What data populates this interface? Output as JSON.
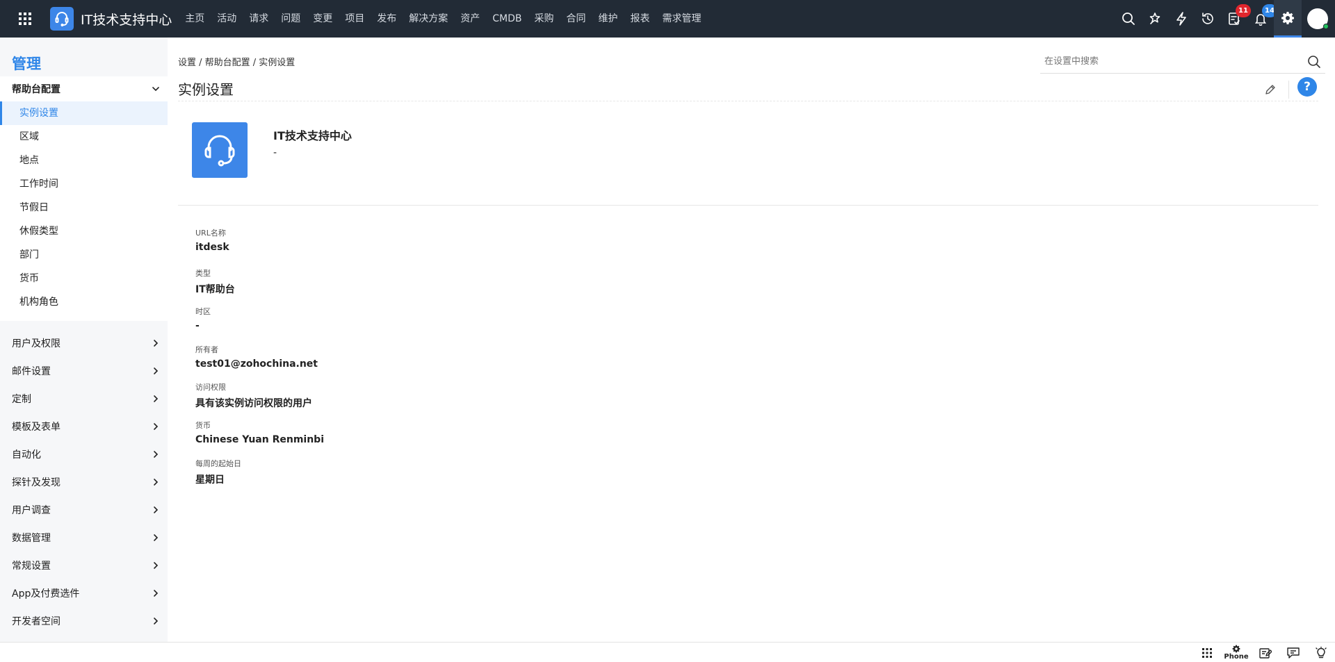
{
  "topbar": {
    "app_title": "IT技术支持中心",
    "nav": [
      "主页",
      "活动",
      "请求",
      "问题",
      "变更",
      "项目",
      "发布",
      "解决方案",
      "资产",
      "CMDB",
      "采购",
      "合同",
      "维护",
      "报表",
      "需求管理"
    ],
    "icons": [
      "search-icon",
      "magic-icon",
      "bolt-icon",
      "history-icon",
      "tasks-icon",
      "bell-icon",
      "gear-icon",
      "avatar"
    ],
    "tasks_badge": "11",
    "notifications_badge": "14",
    "active_color": "#2f86e8",
    "online_color": "#23c15d"
  },
  "sidebar": {
    "title": "管理",
    "group": {
      "label": "帮助台配置",
      "items": [
        "实例设置",
        "区域",
        "地点",
        "工作时间",
        "节假日",
        "休假类型",
        "部门",
        "货币",
        "机构角色"
      ]
    },
    "sections": [
      "用户及权限",
      "邮件设置",
      "定制",
      "模板及表单",
      "自动化",
      "探针及发现",
      "用户调查",
      "数据管理",
      "常规设置",
      "App及付费选件",
      "开发者空间"
    ]
  },
  "main": {
    "breadcrumb": "设置 / 帮助台配置 / 实例设置",
    "search_placeholder": "在设置中搜索",
    "title": "实例设置",
    "help_label": "?",
    "instance_name": "IT技术支持中心",
    "instance_desc": "-",
    "fields": [
      {
        "label": "URL名称",
        "value": "itdesk"
      },
      {
        "label": "类型",
        "value": "IT帮助台"
      },
      {
        "label": "时区",
        "value": "-"
      },
      {
        "label": "所有者",
        "value": "test01@zohochina.net"
      },
      {
        "label": "访问权限",
        "value": "具有该实例访问权限的用户"
      },
      {
        "label": "货币",
        "value": "Chinese Yuan Renminbi"
      },
      {
        "label": "每周的起始日",
        "value": "星期日"
      }
    ]
  },
  "bottombar": {
    "phone_label": "Phone",
    "icons": [
      "apps-grid-icon",
      "phone-gear-icon",
      "note-icon",
      "chat-icon",
      "lightbulb-icon"
    ]
  }
}
